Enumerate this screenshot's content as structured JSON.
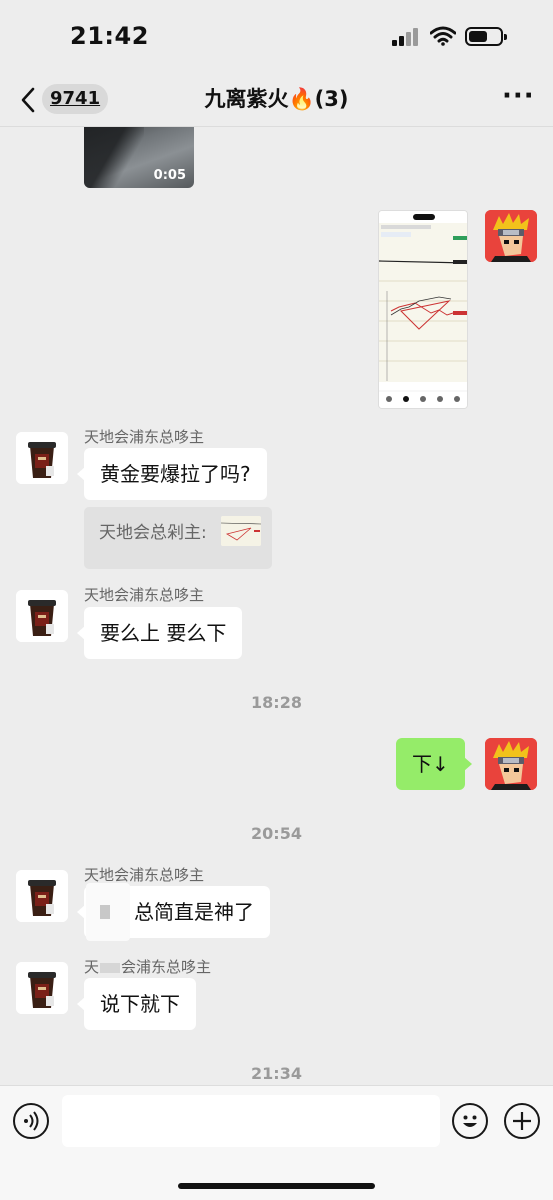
{
  "status_bar": {
    "time": "21:42"
  },
  "nav": {
    "unread_count": "9741",
    "title": "九离紫火🔥(3)",
    "more": "···"
  },
  "messages": {
    "video_duration": "0:05",
    "sender_name": "天地会浦东总哆主",
    "sender_name_partial": "天",
    "sender_name_partial_rest": "会浦东总哆主",
    "msg1": "黄金要爆拉了吗?",
    "quote_text": "天地会总剁主:",
    "msg2": "要么上 要么下",
    "time1": "18:28",
    "self_msg": "下↓",
    "time2": "20:54",
    "msg3": "总简直是神了",
    "msg4": "说下就下",
    "time3": "21:34"
  },
  "colors": {
    "background": "#ededed",
    "self_bubble": "#95ec69",
    "other_bubble": "#ffffff"
  }
}
